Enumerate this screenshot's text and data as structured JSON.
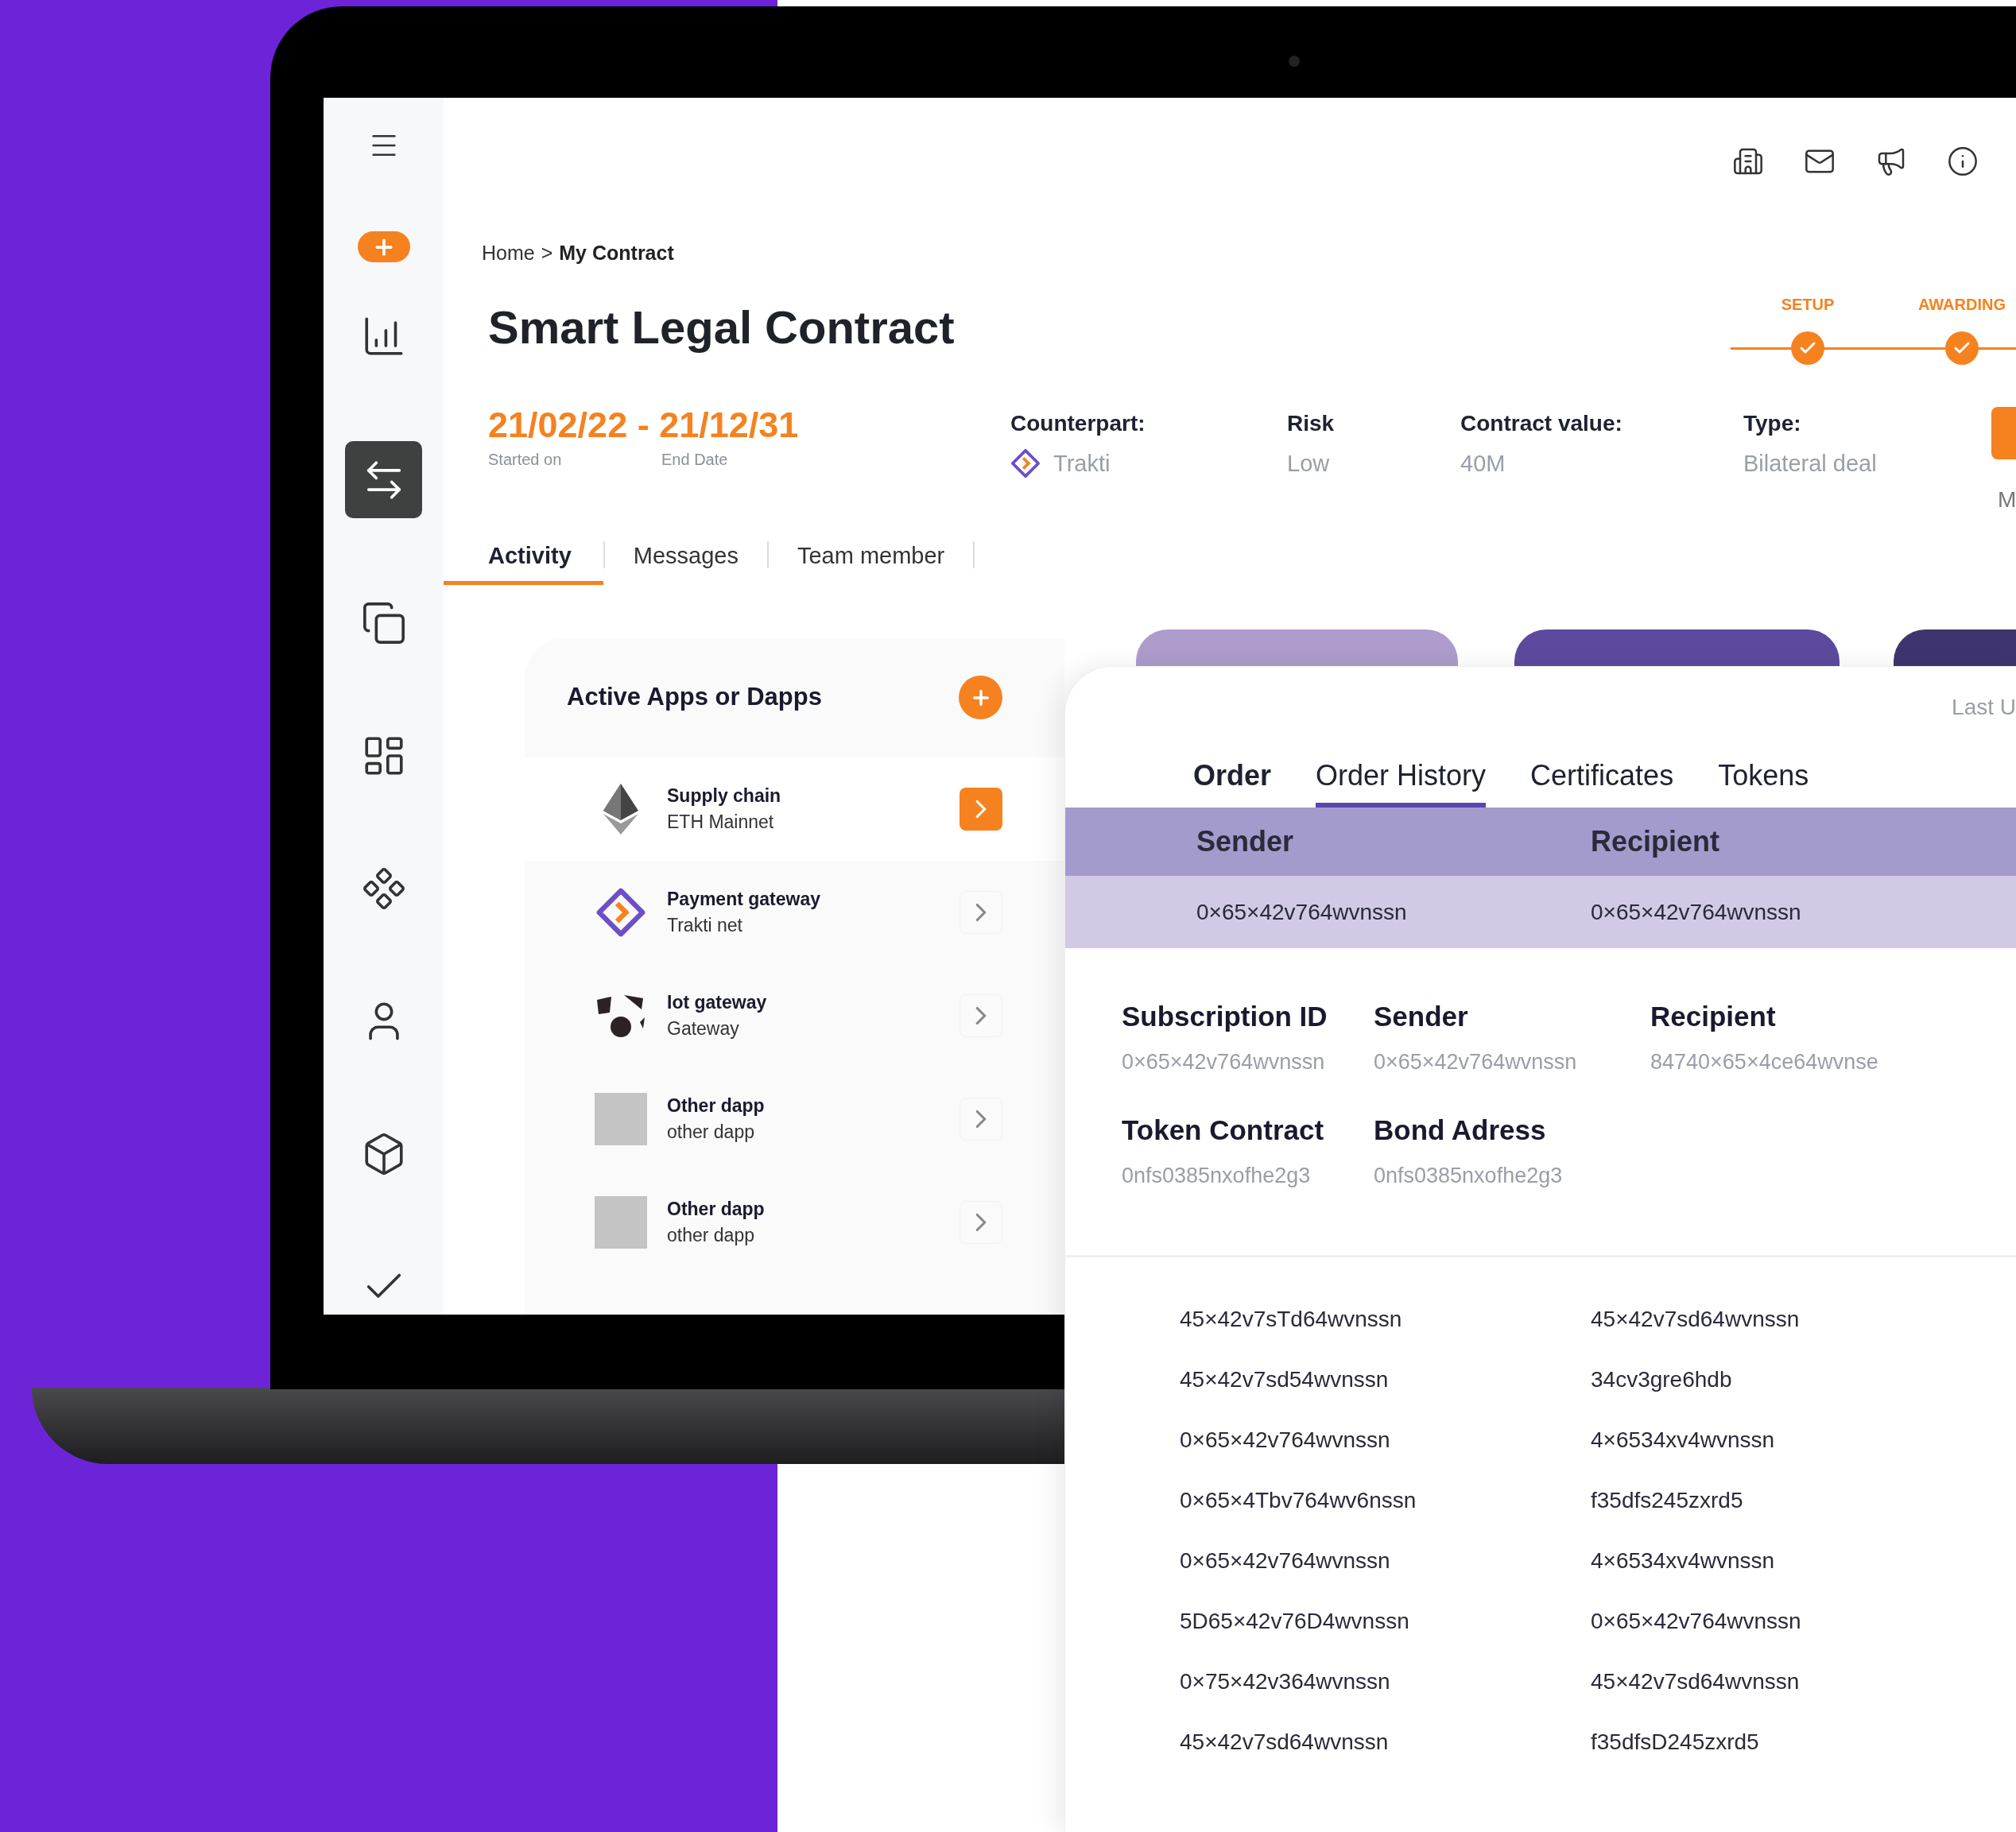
{
  "sidebar": {
    "items": [
      {
        "selected": false
      },
      {
        "selected": true
      },
      {
        "selected": false
      },
      {
        "selected": false
      },
      {
        "selected": false
      },
      {
        "selected": false
      },
      {
        "selected": false
      },
      {
        "selected": false
      }
    ]
  },
  "breadcrumb": {
    "separator": ">",
    "items": [
      {
        "label": "Home",
        "current": false
      },
      {
        "label": "My Contract",
        "current": true
      }
    ]
  },
  "title": "Smart Legal Contract",
  "stepper": [
    {
      "label": "SETUP",
      "done": true
    },
    {
      "label": "AWARDING",
      "done": true
    }
  ],
  "dates": {
    "range": "21/02/22 - 21/12/31",
    "start_label": "Started on",
    "end_label": "End Date"
  },
  "info": [
    {
      "label": "Counterpart:",
      "value": "Trakti",
      "kind": "logo"
    },
    {
      "label": "Risk",
      "value": "Low",
      "kind": "plain"
    },
    {
      "label": "Contract value:",
      "value": "40M",
      "kind": "plain"
    },
    {
      "label": "Type:",
      "value": "Bilateral deal",
      "kind": "plain"
    }
  ],
  "side_note": "M",
  "tabs": [
    {
      "label": "Activity",
      "selected": true
    },
    {
      "label": "Messages",
      "selected": false
    },
    {
      "label": "Team member",
      "selected": false
    }
  ],
  "apps": {
    "title": "Active Apps or Dapps",
    "items": [
      {
        "name": "Supply chain",
        "network": "ETH Mainnet",
        "kind": "eth",
        "selected": true
      },
      {
        "name": "Payment gateway",
        "network": "Trakti net",
        "kind": "trakti",
        "selected": false
      },
      {
        "name": "Iot gateway",
        "network": "Gateway",
        "kind": "iot",
        "selected": false
      },
      {
        "name": "Other dapp",
        "network": "other dapp",
        "kind": "placeholder",
        "selected": false
      },
      {
        "name": "Other dapp",
        "network": "other dapp",
        "kind": "placeholder",
        "selected": false
      }
    ]
  },
  "card": {
    "last_update": "Last U",
    "tabs": [
      {
        "label": "Order",
        "selected": false
      },
      {
        "label": "Order History",
        "selected": true
      },
      {
        "label": "Certificates",
        "selected": false
      },
      {
        "label": "Tokens",
        "selected": false
      }
    ],
    "table": {
      "columns": [
        "Sender",
        "Recipient"
      ],
      "rows": [
        [
          "0×65×42v764wvnssn",
          "0×65×42v764wvnssn"
        ]
      ]
    },
    "details": [
      {
        "label": "Subscription ID",
        "value": "0×65×42v764wvnssn"
      },
      {
        "label": "Sender",
        "value": "0×65×42v764wvnssn"
      },
      {
        "label": "Recipient",
        "value": "84740×65×4ce64wvnse"
      },
      {
        "label": "Token Contract",
        "value": "0nfs0385nxofhe2g3"
      },
      {
        "label": "Bond Adress",
        "value": "0nfs0385nxofhe2g3"
      }
    ],
    "list": [
      [
        "45×42v7sTd64wvnssn",
        "45×42v7sd64wvnssn"
      ],
      [
        "45×42v7sd54wvnssn",
        "34cv3gre6hdb"
      ],
      [
        "0×65×42v764wvnssn",
        "4×6534xv4wvnssn"
      ],
      [
        "0×65×4Tbv764wv6nssn",
        "f35dfs245zxrd5"
      ],
      [
        "0×65×42v764wvnssn",
        "4×6534xv4wvnssn"
      ],
      [
        "5D65×42v76D4wvnssn",
        "0×65×42v764wvnssn"
      ],
      [
        "0×75×42v364wvnssn",
        "45×42v7sd64wvnssn"
      ],
      [
        "45×42v7sd64wvnssn",
        "f35dfsD245zxrd5"
      ]
    ]
  }
}
